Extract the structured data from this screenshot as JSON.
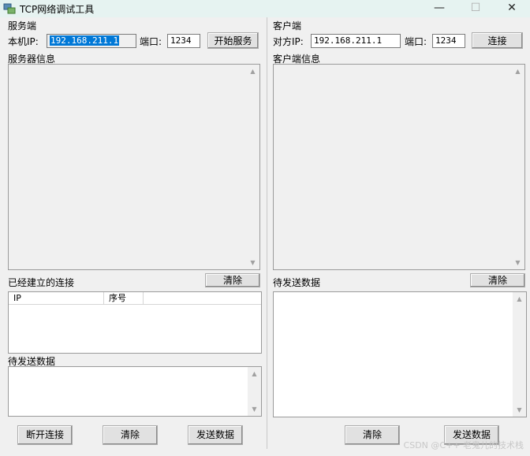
{
  "window": {
    "title": "TCP网络调试工具",
    "minimize_glyph": "—",
    "maximize_glyph": "☐",
    "close_glyph": "✕"
  },
  "server": {
    "section_label": "服务端",
    "local_ip_label": "本机IP:",
    "local_ip_value": "192.168.211.1",
    "port_label": "端口:",
    "port_value": "1234",
    "start_button": "开始服务",
    "info_label": "服务器信息",
    "connections_label": "已经建立的连接",
    "clear_connections_button": "清除",
    "connections_columns": [
      "IP",
      "序号"
    ],
    "send_data_label": "待发送数据",
    "disconnect_button": "断开连接",
    "clear_button": "清除",
    "send_button": "发送数据"
  },
  "client": {
    "section_label": "客户端",
    "remote_ip_label": "对方IP:",
    "remote_ip_value": "192.168.211.1",
    "port_label": "端口:",
    "port_value": "1234",
    "connect_button": "连接",
    "info_label": "客户端信息",
    "send_data_label": "待发送数据",
    "clear_send_button": "清除",
    "clear_button": "清除",
    "send_button": "发送数据"
  },
  "watermark": "CSDN @C++ 老鬼儿的技术栈",
  "icons": [
    "app-network-icon",
    "scroll-up-arrow-icon",
    "scroll-down-arrow-icon"
  ]
}
